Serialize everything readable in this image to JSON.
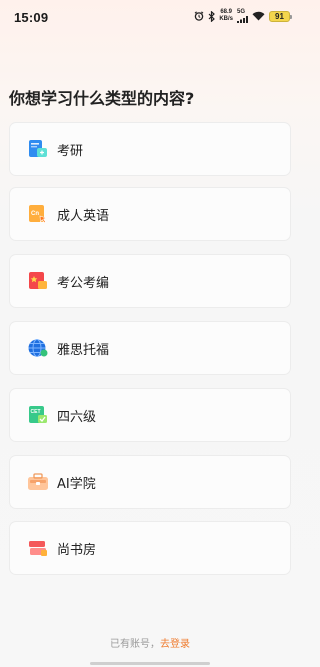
{
  "status_bar": {
    "time": "15:09",
    "net_speed_value": "68.9",
    "net_speed_unit": "KB/s",
    "network_type": "5G",
    "battery": "91"
  },
  "question": "你想学习什么类型的内容?",
  "options": [
    {
      "label": "考研",
      "icon": "postgrad-exam-icon"
    },
    {
      "label": "成人英语",
      "icon": "adult-english-icon"
    },
    {
      "label": "考公考编",
      "icon": "civil-service-exam-icon"
    },
    {
      "label": "雅思托福",
      "icon": "ielts-toefl-globe-icon"
    },
    {
      "label": "四六级",
      "icon": "cet-icon"
    },
    {
      "label": "AI学院",
      "icon": "ai-academy-icon"
    },
    {
      "label": "尚书房",
      "icon": "bookshelf-icon"
    }
  ],
  "footer": {
    "hint": "已有账号，",
    "login_link": "去登录"
  },
  "colors": {
    "accent": "#ef7b2e",
    "card_bg": "#fcfcfc"
  }
}
